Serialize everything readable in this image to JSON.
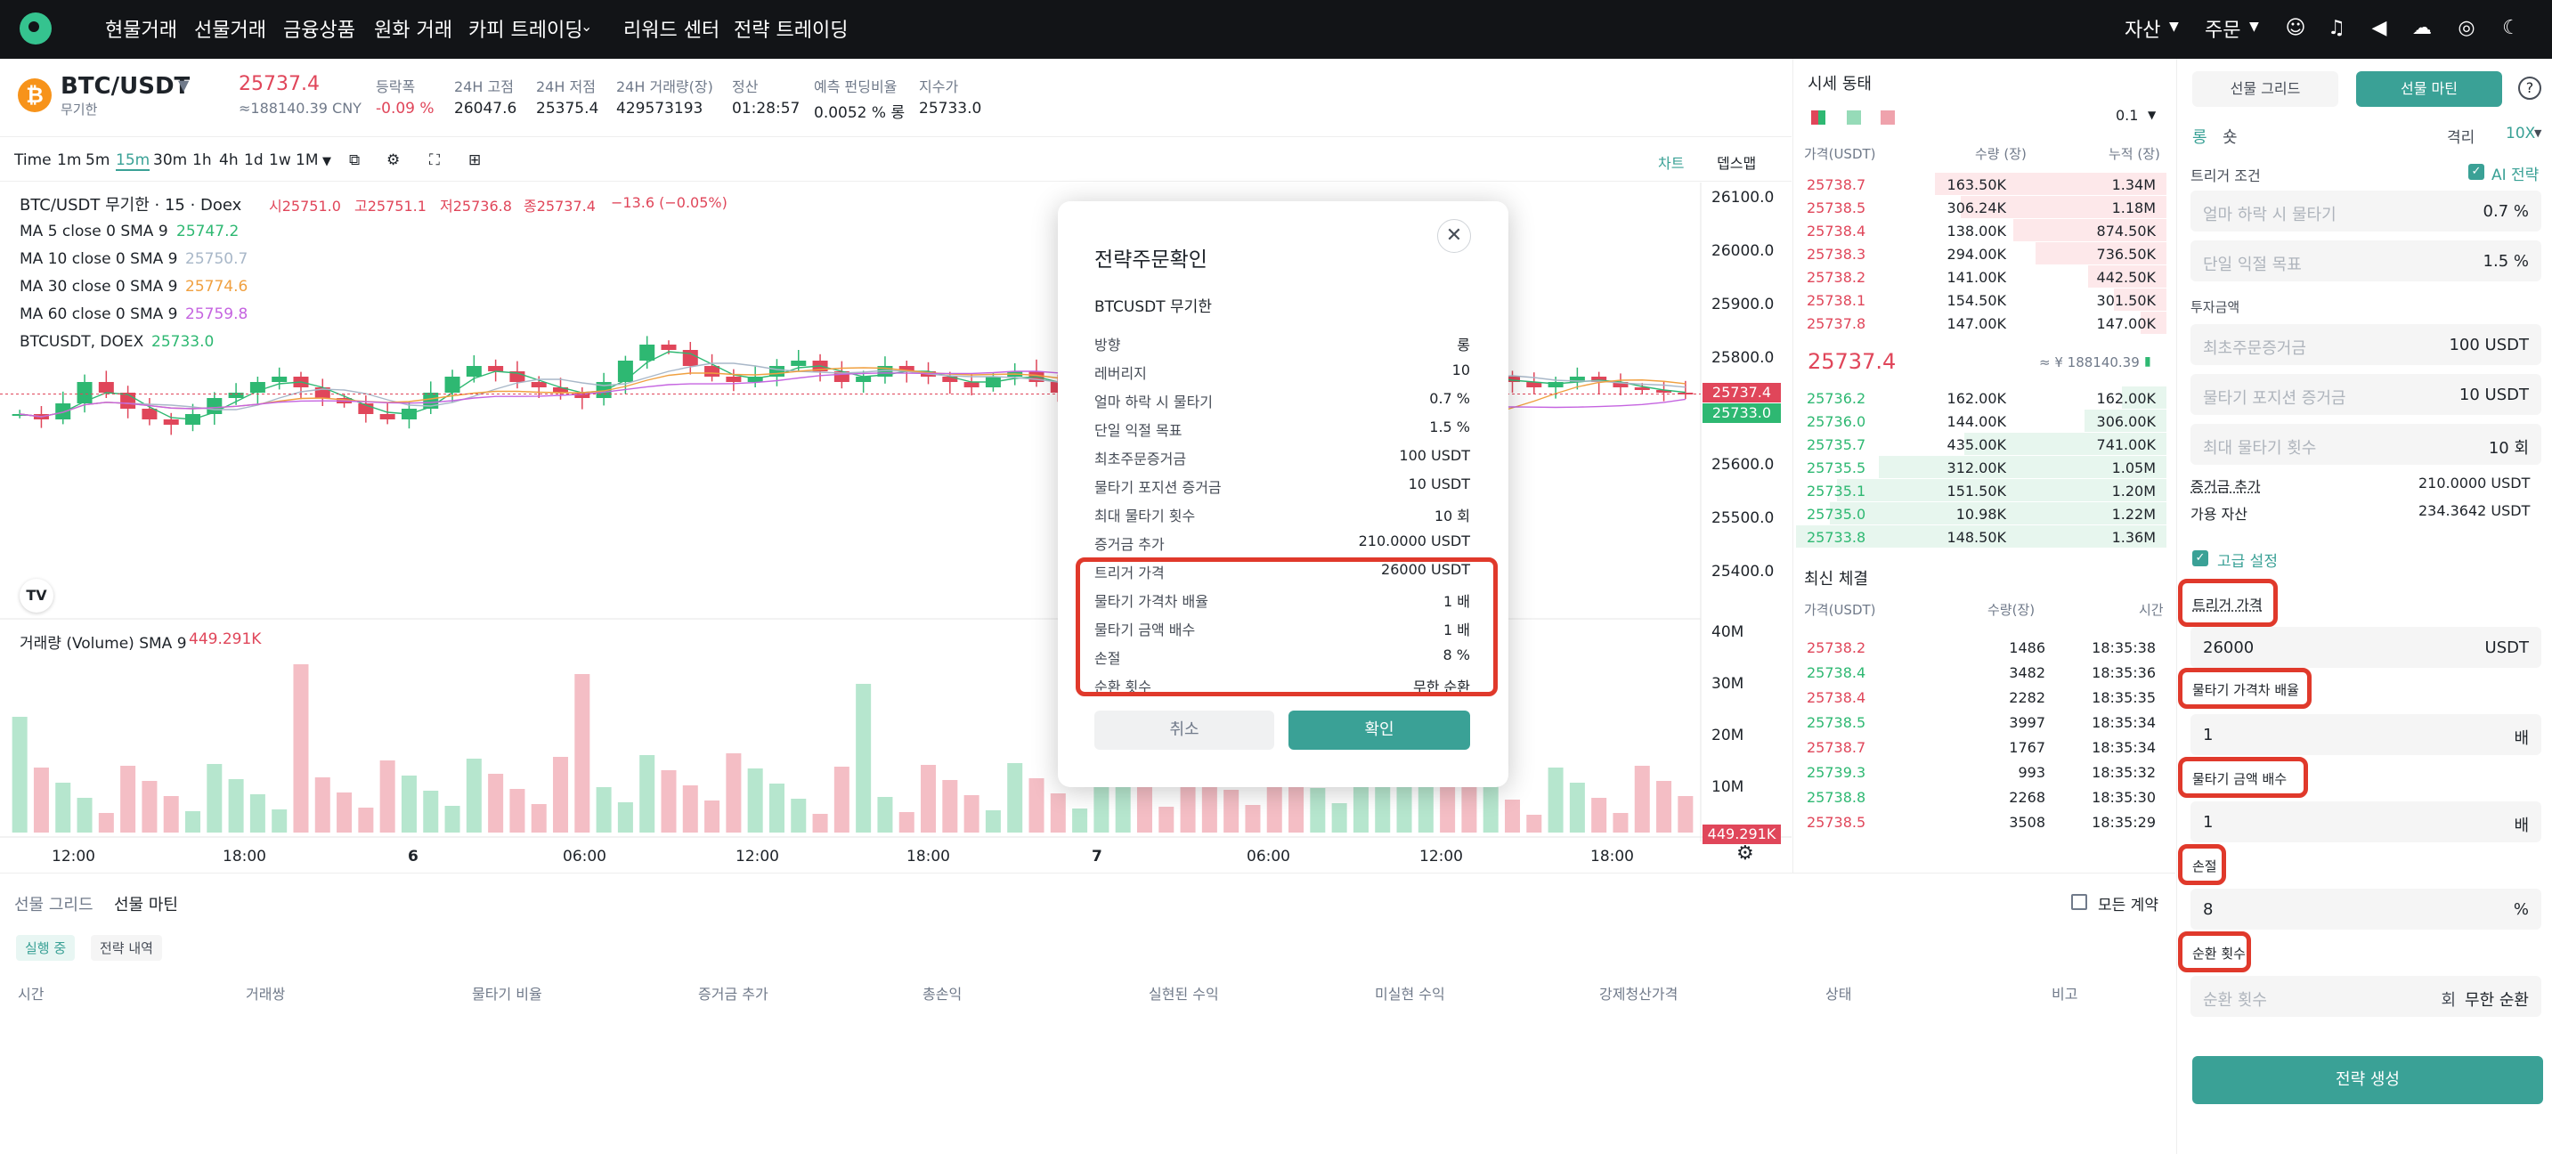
{
  "nav": {
    "items": [
      "현물거래",
      "선물거래",
      "금융상품",
      "원화 거래",
      "카피 트레이딩",
      "리워드 센터",
      "전략 트레이딩"
    ],
    "right": [
      "자산",
      "주문"
    ]
  },
  "ticker": {
    "pair": "BTC/USDT",
    "sub": "무기한",
    "price": "25737.4",
    "cny": "≈188140.39 CNY",
    "stats": [
      {
        "label": "등락폭",
        "value": "-0.09 %"
      },
      {
        "label": "24H 고점",
        "value": "26047.6"
      },
      {
        "label": "24H 저점",
        "value": "25375.4"
      },
      {
        "label": "24H 거래량(장)",
        "value": "429573193"
      },
      {
        "label": "정산",
        "value": "01:28:57"
      },
      {
        "label": "예측 펀딩비율",
        "value": "0.0052 % 롱"
      },
      {
        "label": "지수가",
        "value": "25733.0"
      }
    ]
  },
  "toolbar": {
    "timeframes": [
      "Time",
      "1m",
      "5m",
      "15m",
      "30m",
      "1h",
      "4h",
      "1d",
      "1w",
      "1M"
    ],
    "active": "15m",
    "right": [
      "차트",
      "뎁스맵"
    ]
  },
  "chart_data": {
    "type": "candlestick",
    "title": "BTC/USDT 무기한 · 15 · Doex",
    "ohlc": {
      "open": "시25751.0",
      "high": "고25751.1",
      "low": "저25736.8",
      "close": "종25737.4",
      "change": "−13.6 (−0.05%)"
    },
    "indicators": [
      {
        "name": "MA 5 close 0 SMA 9",
        "value": "25747.2",
        "color": "#2eb872"
      },
      {
        "name": "MA 10 close 0 SMA 9",
        "value": "25750.7",
        "color": "#a8b7c8"
      },
      {
        "name": "MA 30 close 0 SMA 9",
        "value": "25774.6",
        "color": "#f0a040"
      },
      {
        "name": "MA 60 close 0 SMA 9",
        "value": "25759.8",
        "color": "#c564e0"
      },
      {
        "name": "BTCUSDT, DOEX",
        "value": "25733.0",
        "color": "#2eb872"
      }
    ],
    "y_ticks": [
      "26100.0",
      "26000.0",
      "25900.0",
      "25800.0",
      "25600.0",
      "25500.0",
      "25400.0"
    ],
    "last_price": "25737.4",
    "index_price": "25733.0",
    "volume_label": "거래량 (Volume) SMA 9",
    "volume_value": "449.291K",
    "volume_ticks": [
      "40M",
      "30M",
      "20M",
      "10M"
    ],
    "volume_last": "449.291K",
    "x_ticks": [
      "12:00",
      "18:00",
      "6",
      "06:00",
      "12:00",
      "18:00",
      "7",
      "06:00",
      "12:00",
      "18:00"
    ],
    "close_series": [
      25700,
      25690,
      25720,
      25760,
      25740,
      25710,
      25690,
      25680,
      25700,
      25730,
      25740,
      25760,
      25770,
      25750,
      25730,
      25720,
      25700,
      25690,
      25710,
      25740,
      25770,
      25790,
      25780,
      25760,
      25750,
      25740,
      25730,
      25760,
      25800,
      25830,
      25820,
      25790,
      25770,
      25760,
      25770,
      25790,
      25800,
      25780,
      25760,
      25770,
      25790,
      25780,
      25770,
      25760,
      25750,
      25770,
      25780,
      25760,
      25740,
      25750,
      25760,
      25770,
      25760,
      25740,
      25720,
      25700,
      25660,
      25620,
      25600,
      25590,
      25620,
      25660,
      25700,
      25740,
      25770,
      25790,
      25780,
      25760,
      25770,
      25760,
      25750,
      25760,
      25770,
      25760,
      25750,
      25745,
      25740,
      25737
    ]
  },
  "orderbook": {
    "title": "시세 동태",
    "precision": "0.1",
    "headers": [
      "가격(USDT)",
      "수량 (장)",
      "누적 (장)"
    ],
    "asks": [
      [
        "25738.7",
        "163.50K",
        "1.34M"
      ],
      [
        "25738.5",
        "306.24K",
        "1.18M"
      ],
      [
        "25738.4",
        "138.00K",
        "874.50K"
      ],
      [
        "25738.3",
        "294.00K",
        "736.50K"
      ],
      [
        "25738.2",
        "141.00K",
        "442.50K"
      ],
      [
        "25738.1",
        "154.50K",
        "301.50K"
      ],
      [
        "25737.8",
        "147.00K",
        "147.00K"
      ]
    ],
    "ask_depth": [
      0.62,
      0.55,
      0.41,
      0.35,
      0.21,
      0.14,
      0.07
    ],
    "mid_price": "25737.4",
    "mid_cny": "≈ ¥ 188140.39",
    "bids": [
      [
        "25736.2",
        "162.00K",
        "162.00K"
      ],
      [
        "25736.0",
        "144.00K",
        "306.00K"
      ],
      [
        "25735.7",
        "435.00K",
        "741.00K"
      ],
      [
        "25735.5",
        "312.00K",
        "1.05M"
      ],
      [
        "25735.1",
        "151.50K",
        "1.20M"
      ],
      [
        "25735.0",
        "10.98K",
        "1.22M"
      ],
      [
        "25733.8",
        "148.50K",
        "1.36M"
      ]
    ],
    "bid_depth": [
      0.12,
      0.22,
      0.54,
      0.77,
      0.88,
      0.9,
      0.99
    ]
  },
  "trades": {
    "title": "최신 체결",
    "headers": [
      "가격(USDT)",
      "수량(장)",
      "시간"
    ],
    "rows": [
      {
        "p": "25738.2",
        "q": "1486",
        "t": "18:35:38",
        "side": "sell"
      },
      {
        "p": "25738.4",
        "q": "3482",
        "t": "18:35:36",
        "side": "buy"
      },
      {
        "p": "25738.4",
        "q": "2282",
        "t": "18:35:35",
        "side": "sell"
      },
      {
        "p": "25738.5",
        "q": "3997",
        "t": "18:35:34",
        "side": "buy"
      },
      {
        "p": "25738.7",
        "q": "1767",
        "t": "18:35:34",
        "side": "sell"
      },
      {
        "p": "25739.3",
        "q": "993",
        "t": "18:35:32",
        "side": "buy"
      },
      {
        "p": "25738.8",
        "q": "2268",
        "t": "18:35:30",
        "side": "buy"
      },
      {
        "p": "25738.5",
        "q": "3508",
        "t": "18:35:29",
        "side": "sell"
      }
    ]
  },
  "panel": {
    "tabs": [
      "선물 그리드",
      "선물 마틴"
    ],
    "long": "롱",
    "short": "숏",
    "margin_mode": "격리",
    "leverage": "10X",
    "trigger_cond": "트리거 조건",
    "ai_strategy": "AI 전략",
    "f1": {
      "ph": "얼마 하락 시 물타기",
      "val": "0.7 %"
    },
    "f2": {
      "ph": "단일 익절 목표",
      "val": "1.5 %"
    },
    "invest": "투자금액",
    "f3": {
      "ph": "최초주문증거금",
      "val": "100 USDT"
    },
    "f4": {
      "ph": "물타기 포지션 증거금",
      "val": "10 USDT"
    },
    "f5": {
      "ph": "최대 물타기 횟수",
      "val": "10 회"
    },
    "margin_add": {
      "label": "증거금 추가",
      "val": "210.0000 USDT"
    },
    "available": {
      "label": "가용 자산",
      "val": "234.3642 USDT"
    },
    "advanced": "고급 설정",
    "trigger_price": {
      "label": "트리거 가격",
      "val": "26000",
      "unit": "USDT"
    },
    "gap_ratio": {
      "label": "물타기 가격차 배율",
      "val": "1",
      "unit": "배"
    },
    "amount_ratio": {
      "label": "물타기 금액 배수",
      "val": "1",
      "unit": "배"
    },
    "stop_loss": {
      "label": "손절",
      "val": "8",
      "unit": "%"
    },
    "cycles": {
      "label": "순환 횟수",
      "ph": "순환 횟수",
      "unit": "회",
      "val": "무한 순환"
    },
    "create": "전략 생성"
  },
  "bottom": {
    "tabs": [
      "선물 그리드",
      "선물 마틴"
    ],
    "subtabs": [
      "실행 중",
      "전략 내역"
    ],
    "all_contracts": "모든 계약",
    "columns": [
      "시간",
      "거래쌍",
      "물타기 비율",
      "증거금 추가",
      "총손익",
      "실현된 수익",
      "미실현 수익",
      "강제청산가격",
      "상태",
      "비고"
    ]
  },
  "modal": {
    "title": "전략주문확인",
    "subtitle": "BTCUSDT 무기한",
    "rows": [
      [
        "방향",
        "롱"
      ],
      [
        "레버리지",
        "10"
      ],
      [
        "얼마 하락 시 물타기",
        "0.7 %"
      ],
      [
        "단일 익절 목표",
        "1.5 %"
      ],
      [
        "최초주문증거금",
        "100 USDT"
      ],
      [
        "물타기 포지션 증거금",
        "10 USDT"
      ],
      [
        "최대 물타기 횟수",
        "10 회"
      ],
      [
        "증거금 추가",
        "210.0000 USDT"
      ],
      [
        "트리거 가격",
        "26000 USDT"
      ],
      [
        "물타기 가격차 배율",
        "1 배"
      ],
      [
        "물타기 금액 배수",
        "1 배"
      ],
      [
        "손절",
        "8 %"
      ],
      [
        "순환 횟수",
        "무한 순환"
      ]
    ],
    "cancel": "취소",
    "confirm": "확인"
  },
  "colors": {
    "green": "#2eb872",
    "red": "#e0465a",
    "accent": "#3aa196",
    "highlight": "#e0392b"
  }
}
